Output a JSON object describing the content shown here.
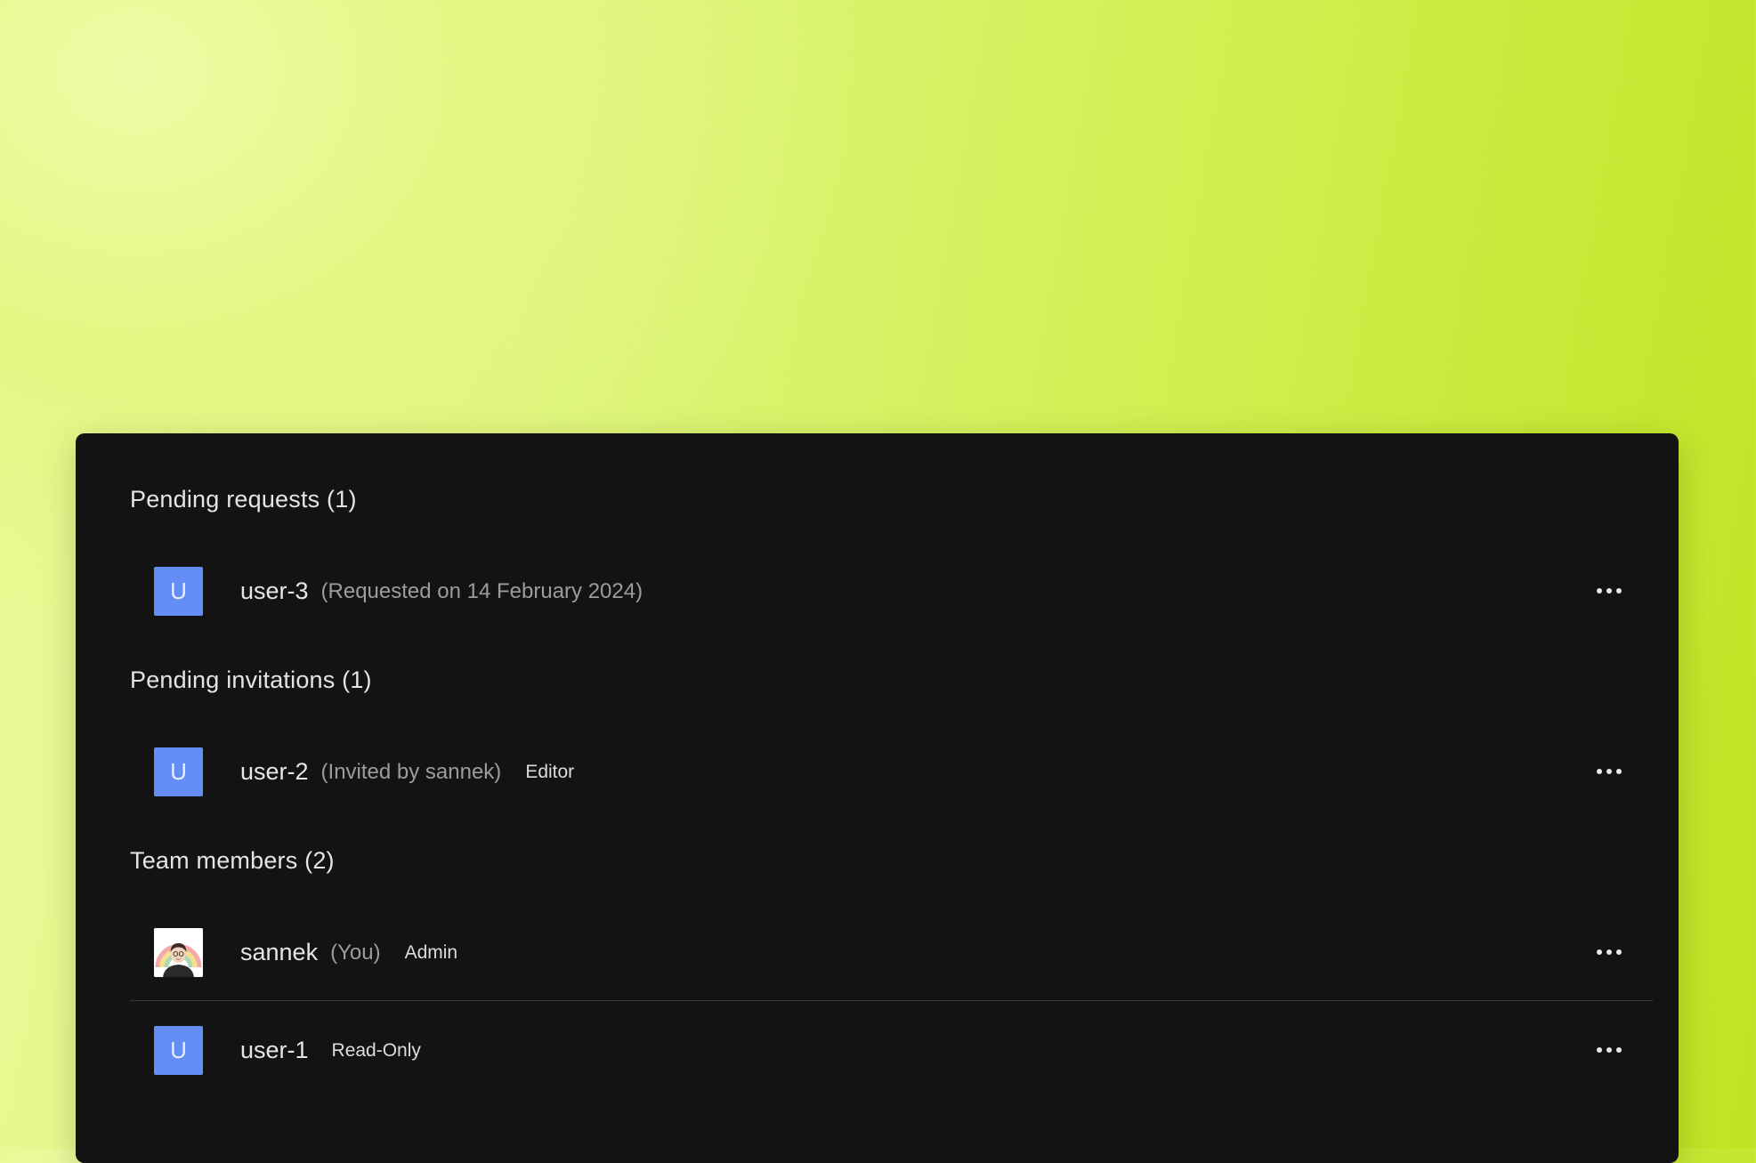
{
  "sections": {
    "pending_requests": {
      "title": "Pending requests (1)",
      "rows": [
        {
          "avatar_letter": "U",
          "name": "user-3",
          "note": "(Requested on 14 February 2024)"
        }
      ]
    },
    "pending_invitations": {
      "title": "Pending invitations (1)",
      "rows": [
        {
          "avatar_letter": "U",
          "name": "user-2",
          "note": "(Invited by sannek)",
          "role": "Editor"
        }
      ]
    },
    "team_members": {
      "title": "Team members (2)",
      "rows": [
        {
          "avatar": "profile-photo",
          "name": "sannek",
          "note": "(You)",
          "role": "Admin"
        },
        {
          "avatar_letter": "U",
          "name": "user-1",
          "role": "Read-Only"
        }
      ]
    }
  },
  "icons": {
    "row_menu": "more-horizontal-icon"
  },
  "colors": {
    "panel_background": "#131313",
    "avatar_background": "#648df5",
    "page_gradient_start": "#ebfb9d",
    "page_gradient_end": "#c0e321"
  }
}
